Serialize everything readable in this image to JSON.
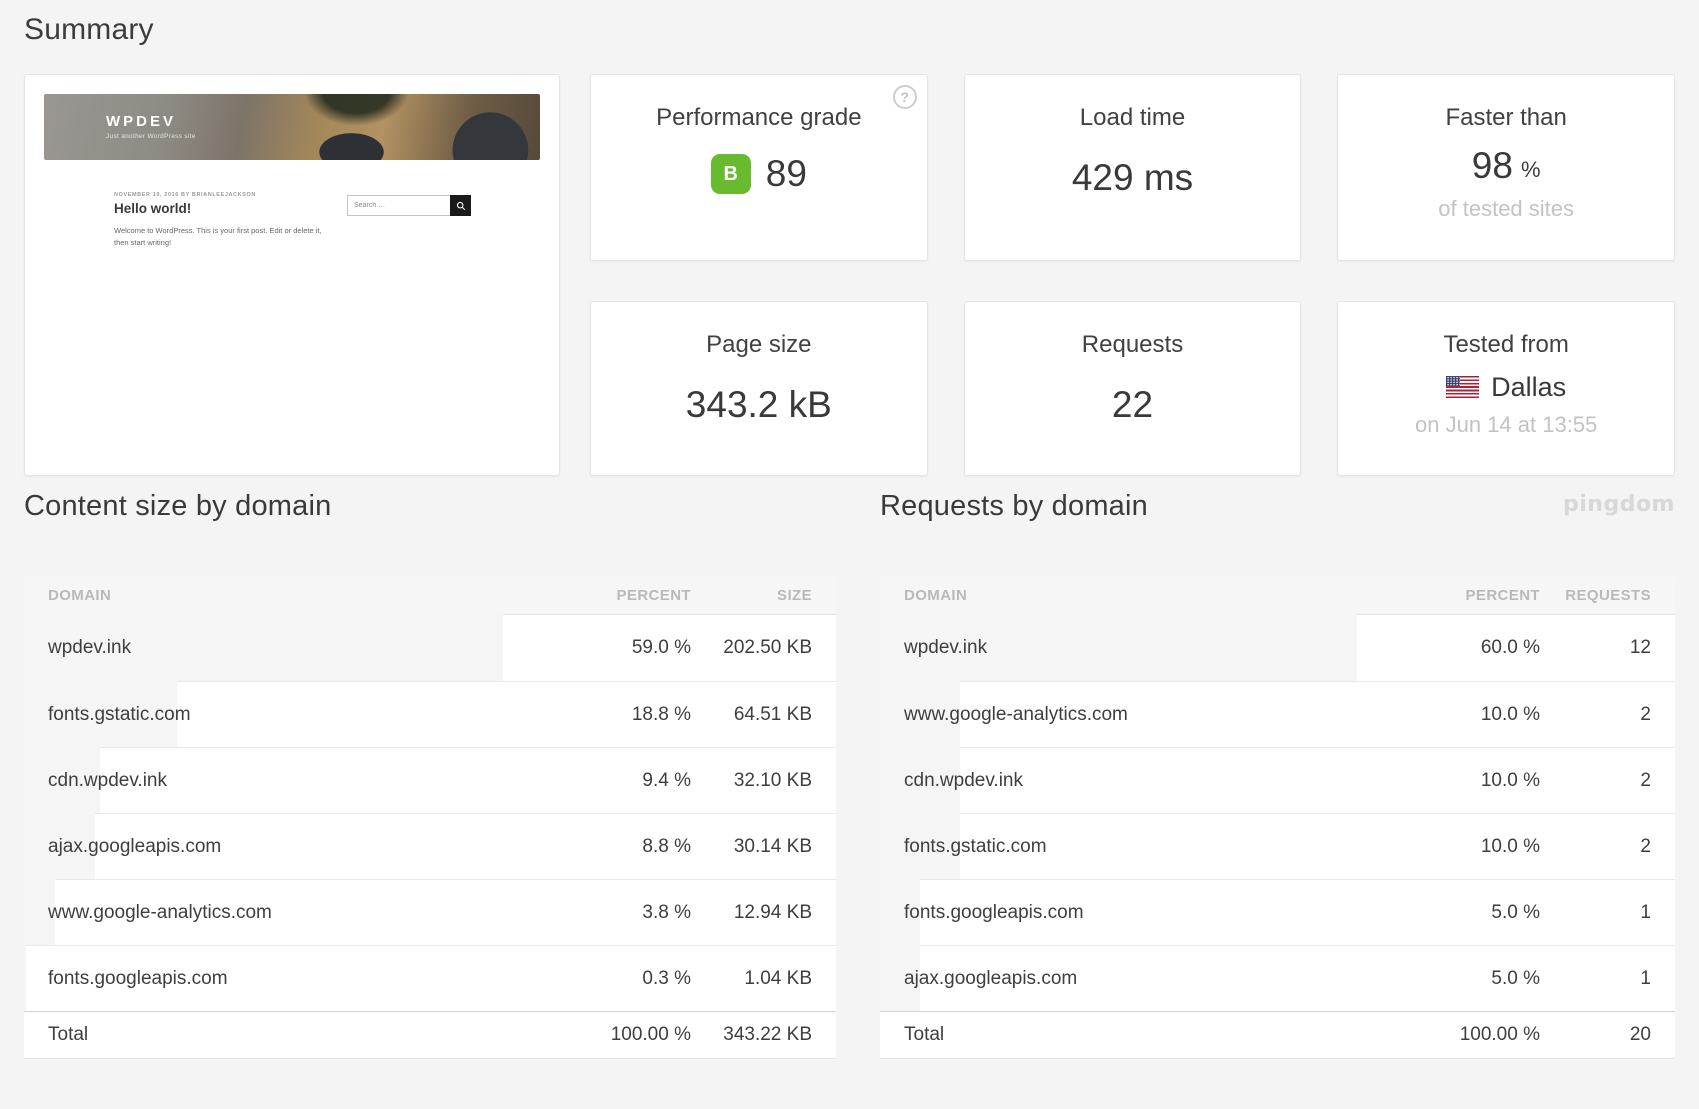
{
  "page": {
    "title": "Summary",
    "brand_watermark": "pingdom"
  },
  "colors": {
    "grade_green": "#68bb2f",
    "bar_gray": "#f5f5f5"
  },
  "thumbnail": {
    "site_title": "WPDEV",
    "site_tagline": "Just another WordPress site",
    "post_meta": "NOVEMBER 19, 2016 BY BRIANLEEJACKSON",
    "post_title": "Hello world!",
    "post_body": "Welcome to WordPress. This is your first post. Edit or delete it, then start writing!",
    "search_placeholder": "Search …"
  },
  "cards": {
    "performance_grade": {
      "label": "Performance grade",
      "help_icon": "?",
      "grade_letter": "B",
      "value": "89"
    },
    "load_time": {
      "label": "Load time",
      "value": "429 ms"
    },
    "faster_than": {
      "label": "Faster than",
      "value": "98",
      "unit": "%",
      "subtext": "of tested sites"
    },
    "page_size": {
      "label": "Page size",
      "value": "343.2 kB"
    },
    "requests": {
      "label": "Requests",
      "value": "22"
    },
    "tested_from": {
      "label": "Tested from",
      "city": "Dallas",
      "subtext": "on Jun 14 at 13:55"
    }
  },
  "tables": {
    "content_size": {
      "title": "Content size by domain",
      "columns": [
        "DOMAIN",
        "PERCENT",
        "SIZE"
      ],
      "rows": [
        {
          "domain": "wpdev.ink",
          "percent": "59.0 %",
          "percent_value": 59.0,
          "value": "202.50 KB"
        },
        {
          "domain": "fonts.gstatic.com",
          "percent": "18.8 %",
          "percent_value": 18.8,
          "value": "64.51 KB"
        },
        {
          "domain": "cdn.wpdev.ink",
          "percent": "9.4 %",
          "percent_value": 9.4,
          "value": "32.10 KB"
        },
        {
          "domain": "ajax.googleapis.com",
          "percent": "8.8 %",
          "percent_value": 8.8,
          "value": "30.14 KB"
        },
        {
          "domain": "www.google-analytics.com",
          "percent": "3.8 %",
          "percent_value": 3.8,
          "value": "12.94 KB"
        },
        {
          "domain": "fonts.googleapis.com",
          "percent": "0.3 %",
          "percent_value": 0.3,
          "value": "1.04 KB"
        }
      ],
      "total": {
        "label": "Total",
        "percent": "100.00 %",
        "value": "343.22 KB"
      }
    },
    "requests_by_domain": {
      "title": "Requests by domain",
      "columns": [
        "DOMAIN",
        "PERCENT",
        "REQUESTS"
      ],
      "rows": [
        {
          "domain": "wpdev.ink",
          "percent": "60.0 %",
          "percent_value": 60.0,
          "value": "12"
        },
        {
          "domain": "www.google-analytics.com",
          "percent": "10.0 %",
          "percent_value": 10.0,
          "value": "2"
        },
        {
          "domain": "cdn.wpdev.ink",
          "percent": "10.0 %",
          "percent_value": 10.0,
          "value": "2"
        },
        {
          "domain": "fonts.gstatic.com",
          "percent": "10.0 %",
          "percent_value": 10.0,
          "value": "2"
        },
        {
          "domain": "fonts.googleapis.com",
          "percent": "5.0 %",
          "percent_value": 5.0,
          "value": "1"
        },
        {
          "domain": "ajax.googleapis.com",
          "percent": "5.0 %",
          "percent_value": 5.0,
          "value": "1"
        }
      ],
      "total": {
        "label": "Total",
        "percent": "100.00 %",
        "value": "20"
      }
    }
  }
}
